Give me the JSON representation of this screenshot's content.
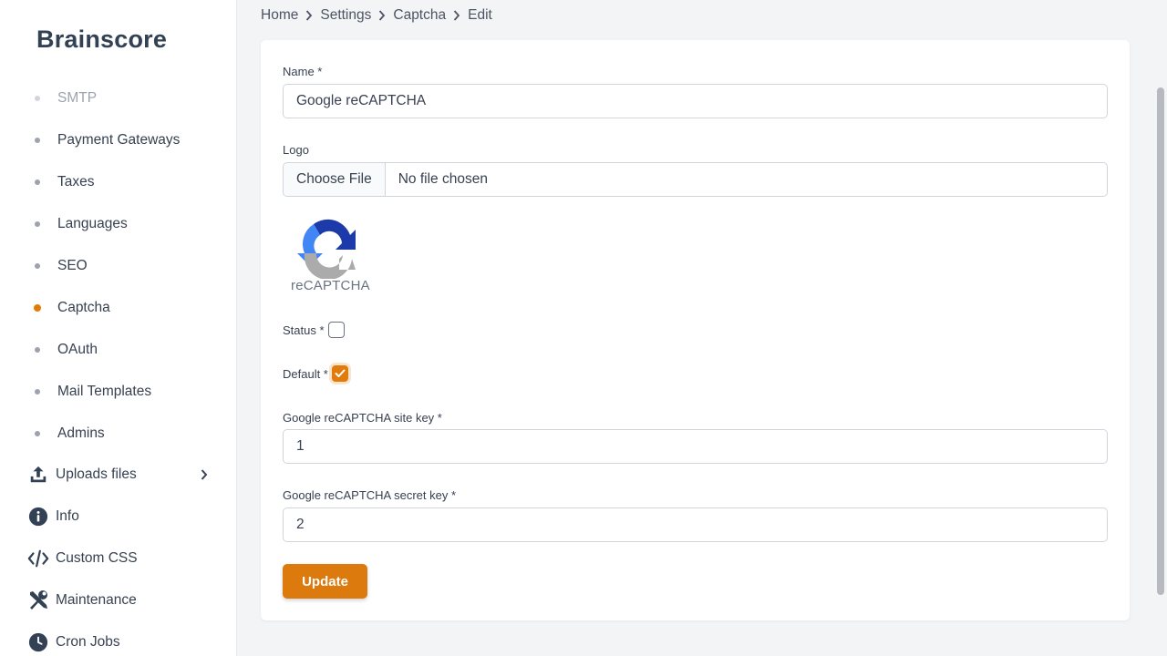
{
  "brand": "Brainscore",
  "sidebar": {
    "sub_items": [
      {
        "label": "SMTP",
        "state": "faded"
      },
      {
        "label": "Payment Gateways",
        "state": "normal"
      },
      {
        "label": "Taxes",
        "state": "normal"
      },
      {
        "label": "Languages",
        "state": "normal"
      },
      {
        "label": "SEO",
        "state": "normal"
      },
      {
        "label": "Captcha",
        "state": "active"
      },
      {
        "label": "OAuth",
        "state": "normal"
      },
      {
        "label": "Mail Templates",
        "state": "normal"
      },
      {
        "label": "Admins",
        "state": "normal"
      }
    ],
    "main_items": [
      {
        "label": "Uploads files",
        "icon": "upload-icon",
        "has_submenu": true
      },
      {
        "label": "Info",
        "icon": "info-icon",
        "has_submenu": false
      },
      {
        "label": "Custom CSS",
        "icon": "code-icon",
        "has_submenu": false
      },
      {
        "label": "Maintenance",
        "icon": "tools-icon",
        "has_submenu": false
      },
      {
        "label": "Cron Jobs",
        "icon": "clock-icon",
        "has_submenu": false
      }
    ]
  },
  "breadcrumb": [
    "Home",
    "Settings",
    "Captcha",
    "Edit"
  ],
  "form": {
    "name_label": "Name *",
    "name_value": "Google reCAPTCHA",
    "logo_label": "Logo",
    "file_button": "Choose File",
    "file_status": "No file chosen",
    "logo_caption": "reCAPTCHA",
    "status_label": "Status *",
    "status_checked": false,
    "default_label": "Default *",
    "default_checked": true,
    "site_key_label": "Google reCAPTCHA site key *",
    "site_key_value": "1",
    "secret_key_label": "Google reCAPTCHA secret key *",
    "secret_key_value": "2",
    "submit_label": "Update"
  },
  "colors": {
    "accent": "#dd7a0e",
    "recaptcha_blue": "#1c3aa9",
    "recaptcha_light_blue": "#4285f4",
    "recaptcha_gray": "#ababab"
  }
}
